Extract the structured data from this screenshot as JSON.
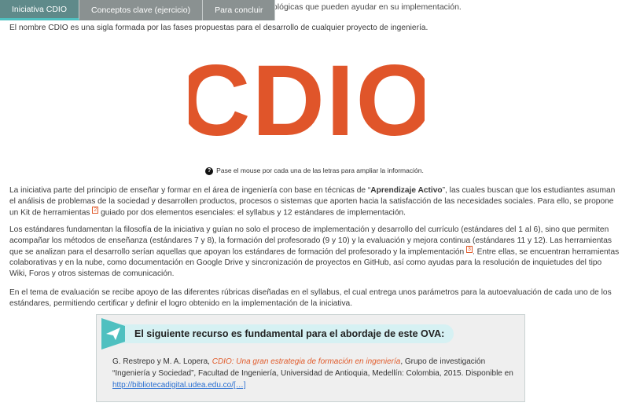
{
  "tabs": [
    {
      "label": "Iniciativa CDIO"
    },
    {
      "label": "Conceptos clave (ejercicio)"
    },
    {
      "label": "Para concluir"
    }
  ],
  "partial_line": "ecnológicas que pueden ayudar en su implementación.",
  "intro": "El nombre CDIO es una sigla formada por las fases propuestas para el desarrollo de cualquier proyecto de ingeniería.",
  "logo": {
    "text": "CDIO",
    "color": "#e0552a"
  },
  "hint": {
    "icon": "question-icon",
    "icon_glyph": "?",
    "text": "Pase el mouse por cada una de las letras para ampliar la información."
  },
  "paragraph1": {
    "pre": "La iniciativa parte del principio de enseñar y formar en el área de ingeniería con base en técnicas de “",
    "bold": "Aprendizaje Activo",
    "post": "”, las cuales buscan que los estudiantes asuman el análisis de problemas de la sociedad y desarrollen productos, procesos o sistemas que aporten hacia la satisfacción de las necesidades sociales. Para ello, se propone un Kit de herramientas ",
    "ref": "2",
    "post2": " guiado por dos elementos esenciales: el syllabus y 12 estándares de implementación."
  },
  "paragraph2": {
    "pre": "Los estándares fundamentan la filosofía de la iniciativa y guían no solo el proceso de implementación y desarrollo del currículo (estándares del 1 al 6), sino que permiten acompañar los métodos de enseñanza (estándares 7 y 8), la formación del profesorado (9 y 10) y la evaluación y mejora continua (estándares 11 y 12). Las herramientas que se analizan para el desarrollo serían aquellas que apoyan los estándares de formación del profesorado y la implementación ",
    "ref": "3",
    "post": ". Entre ellas, se encuentran herramientas colaborativas y en la nube, como documentación en Google Drive y sincronización de proyectos en GitHub, así como ayudas para la resolución de inquietudes del tipo Wiki, Foros y otros sistemas de comunicación."
  },
  "paragraph3": "En el tema de evaluación se recibe apoyo de las diferentes rúbricas diseñadas en el syllabus, el cual entrega unos parámetros para la autoevaluación de cada uno de los estándares, permitiendo certificar y definir el logro obtenido en la implementación de la iniciativa.",
  "resource": {
    "badge_icon": "paper-plane-icon",
    "title": "El siguiente recurso es fundamental para el abordaje de este OVA:",
    "authors": "G. Restrepo y M. A. Lopera, ",
    "work": "CDIO: Una gran estrategia de formación en ingeniería",
    "details": ", Grupo de investigación “Ingeniería y Sociedad”, Facultad de Ingeniería, Universidad de Antioquia, Medellín: Colombia, 2015. Disponible en ",
    "link": "http://bibliotecadigital.udea.edu.co/[…]"
  },
  "colors": {
    "accent": "#e0552a",
    "tab_bg": "#8a9191",
    "tab_active": "#5f8a8a",
    "resource_head": "#d6f1f3",
    "link": "#2a6fd1"
  }
}
